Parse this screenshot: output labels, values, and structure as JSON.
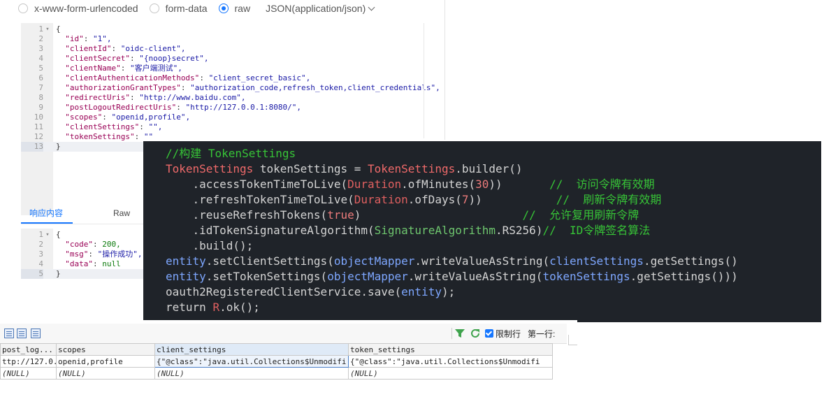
{
  "request": {
    "body_types": [
      {
        "label": "x-www-form-urlencoded",
        "selected": false
      },
      {
        "label": "form-data",
        "selected": false
      },
      {
        "label": "raw",
        "selected": true
      }
    ],
    "format": "JSON(application/json)",
    "lines": [
      {
        "n": "1",
        "fold": "▾",
        "text": "{"
      },
      {
        "n": "2",
        "key": "\"id\"",
        "val": "\"1\","
      },
      {
        "n": "3",
        "key": "\"clientId\"",
        "val": "\"oidc-client\","
      },
      {
        "n": "4",
        "key": "\"clientSecret\"",
        "val": "\"{noop}secret\","
      },
      {
        "n": "5",
        "key": "\"clientName\"",
        "val": "\"客户端测试\","
      },
      {
        "n": "6",
        "key": "\"clientAuthenticationMethods\"",
        "val": "\"client_secret_basic\","
      },
      {
        "n": "7",
        "key": "\"authorizationGrantTypes\"",
        "val": "\"authorization_code,refresh_token,client_credentials\","
      },
      {
        "n": "8",
        "key": "\"redirectUris\"",
        "val": "\"http://www.baidu.com\","
      },
      {
        "n": "9",
        "key": "\"postLogoutRedirectUris\"",
        "val": "\"http://127.0.0.1:8080/\","
      },
      {
        "n": "10",
        "key": "\"scopes\"",
        "val": "\"openid,profile\","
      },
      {
        "n": "11",
        "key": "\"clientSettings\"",
        "val": "\"\","
      },
      {
        "n": "12",
        "key": "\"tokenSettings\"",
        "val": "\"\""
      },
      {
        "n": "13",
        "text": "}",
        "active": true
      }
    ]
  },
  "response": {
    "tabs": [
      "响应内容",
      "Raw"
    ],
    "lines": [
      {
        "n": "1",
        "fold": "▾",
        "text": "{"
      },
      {
        "n": "2",
        "key": "\"code\"",
        "num": "200,"
      },
      {
        "n": "3",
        "key": "\"msg\"",
        "val": "\"操作成功\","
      },
      {
        "n": "4",
        "key": "\"data\"",
        "num": "null"
      },
      {
        "n": "5",
        "text": "}",
        "active": true
      }
    ]
  },
  "code": {
    "l1": "//构建 TokenSettings",
    "l2_type": "TokenSettings",
    "l2_rest": " tokenSettings = ",
    "l2_type2": "TokenSettings",
    "l2_end": ".builder()",
    "l3_a": "    .accessTokenTimeToLive(",
    "l3_cls": "Duration",
    "l3_b": ".ofMinutes(",
    "l3_num": "30",
    "l3_c": "))       ",
    "l3_cm": "//  访问令牌有效期",
    "l4_a": "    .refreshTokenTimeToLive(",
    "l4_cls": "Duration",
    "l4_b": ".ofDays(",
    "l4_num": "7",
    "l4_c": "))           ",
    "l4_cm": "//  刷新令牌有效期",
    "l5_a": "    .reuseRefreshTokens(",
    "l5_kw": "true",
    "l5_c": ")                        ",
    "l5_cm": "//  允许复用刷新令牌",
    "l6_a": "    .idTokenSignatureAlgorithm(",
    "l6_cls": "SignatureAlgorithm",
    "l6_b": ".RS256)",
    "l6_cm": "//  ID令牌签名算法",
    "l7": "    .build();",
    "l8_var": "entity",
    "l8_a": ".setClientSettings(",
    "l8_var2": "objectMapper",
    "l8_b": ".writeValueAsString(",
    "l8_var3": "clientSettings",
    "l8_c": ".getSettings()",
    "l9_var": "entity",
    "l9_a": ".setTokenSettings(",
    "l9_var2": "objectMapper",
    "l9_b": ".writeValueAsString(",
    "l9_var3": "tokenSettings",
    "l9_c": ".getSettings()))",
    "l10_a": "oauth2RegisteredClientService.save(",
    "l10_var": "entity",
    "l10_b": ");",
    "l11_kw": "return ",
    "l11_cls": "R",
    "l11_b": ".ok();"
  },
  "sql": {
    "limit_label": "限制行",
    "first_row_label": "第一行:",
    "columns": [
      "post_log...",
      "scopes",
      "client_settings",
      "token_settings"
    ],
    "row1": [
      "ttp://127.0.0.1:8080/",
      "openid,profile",
      "{\"@class\":\"java.util.Collections$Unmodifi",
      "{\"@class\":\"java.util.Collections$Unmodifi"
    ],
    "row2": [
      "(NULL)",
      "(NULL)",
      "(NULL)",
      "(NULL)"
    ]
  }
}
